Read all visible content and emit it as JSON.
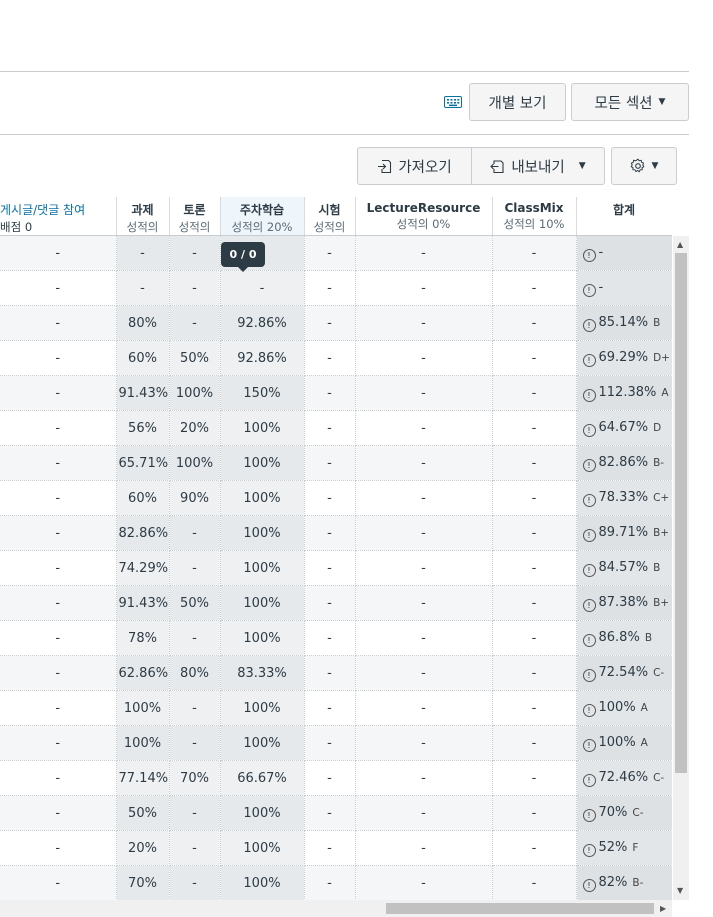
{
  "toolbar1": {
    "keyboard_icon": "keyboard-icon",
    "individual_view": "개별 보기",
    "all_sections": "모든 섹션"
  },
  "toolbar2": {
    "import": "가져오기",
    "export": "내보내기",
    "import_icon": "import-icon",
    "export_icon": "export-icon",
    "settings_icon": "gear-icon"
  },
  "tooltip": "0 / 0",
  "columns": [
    {
      "title": "게시글/댓글 참여",
      "sub": "배점 0"
    },
    {
      "title": "과제",
      "sub": "성적의"
    },
    {
      "title": "토론",
      "sub": "성적의"
    },
    {
      "title": "주차학습",
      "sub": "성적의 20%"
    },
    {
      "title": "시험",
      "sub": "성적의"
    },
    {
      "title": "LectureResource",
      "sub": "성적의 0%"
    },
    {
      "title": "ClassMix",
      "sub": "성적의 10%"
    },
    {
      "title": "합계",
      "sub": ""
    }
  ],
  "rows": [
    [
      "-",
      "-",
      "-",
      "",
      "-",
      "-",
      "-",
      "-",
      ""
    ],
    [
      "-",
      "-",
      "-",
      "-",
      "-",
      "-",
      "-",
      "-",
      ""
    ],
    [
      "-",
      "80%",
      "-",
      "92.86%",
      "-",
      "-",
      "-",
      "85.14%",
      "B"
    ],
    [
      "-",
      "60%",
      "50%",
      "92.86%",
      "-",
      "-",
      "-",
      "69.29%",
      "D+"
    ],
    [
      "-",
      "91.43%",
      "100%",
      "150%",
      "-",
      "-",
      "-",
      "112.38%",
      "A"
    ],
    [
      "-",
      "56%",
      "20%",
      "100%",
      "-",
      "-",
      "-",
      "64.67%",
      "D"
    ],
    [
      "-",
      "65.71%",
      "100%",
      "100%",
      "-",
      "-",
      "-",
      "82.86%",
      "B-"
    ],
    [
      "-",
      "60%",
      "90%",
      "100%",
      "-",
      "-",
      "-",
      "78.33%",
      "C+"
    ],
    [
      "-",
      "82.86%",
      "-",
      "100%",
      "-",
      "-",
      "-",
      "89.71%",
      "B+"
    ],
    [
      "-",
      "74.29%",
      "-",
      "100%",
      "-",
      "-",
      "-",
      "84.57%",
      "B"
    ],
    [
      "-",
      "91.43%",
      "50%",
      "100%",
      "-",
      "-",
      "-",
      "87.38%",
      "B+"
    ],
    [
      "-",
      "78%",
      "-",
      "100%",
      "-",
      "-",
      "-",
      "86.8%",
      "B"
    ],
    [
      "-",
      "62.86%",
      "80%",
      "83.33%",
      "-",
      "-",
      "-",
      "72.54%",
      "C-"
    ],
    [
      "-",
      "100%",
      "-",
      "100%",
      "-",
      "-",
      "-",
      "100%",
      "A"
    ],
    [
      "-",
      "100%",
      "-",
      "100%",
      "-",
      "-",
      "-",
      "100%",
      "A"
    ],
    [
      "-",
      "77.14%",
      "70%",
      "66.67%",
      "-",
      "-",
      "-",
      "72.46%",
      "C-"
    ],
    [
      "-",
      "50%",
      "-",
      "100%",
      "-",
      "-",
      "-",
      "70%",
      "C-"
    ],
    [
      "-",
      "20%",
      "-",
      "100%",
      "-",
      "-",
      "-",
      "52%",
      "F"
    ],
    [
      "-",
      "70%",
      "-",
      "100%",
      "-",
      "-",
      "-",
      "82%",
      "B-"
    ]
  ]
}
